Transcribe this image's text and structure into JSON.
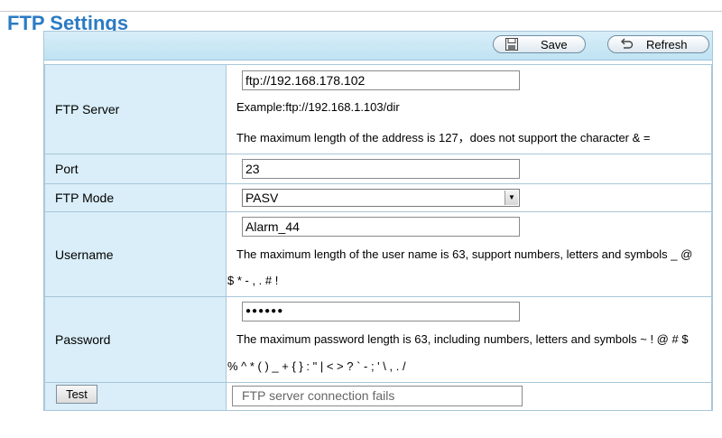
{
  "page": {
    "title": "FTP Settings"
  },
  "toolbar": {
    "save_label": "Save",
    "refresh_label": "Refresh"
  },
  "form": {
    "ftp_server": {
      "label": "FTP Server",
      "value": "ftp://192.168.178.102",
      "example": "Example:ftp://192.168.1.103/dir",
      "note": "The maximum length of the address is 127，does not support the character & ="
    },
    "port": {
      "label": "Port",
      "value": "23"
    },
    "ftp_mode": {
      "label": "FTP Mode",
      "selected": "PASV"
    },
    "username": {
      "label": "Username",
      "value": "Alarm_44",
      "note_line1": "The maximum length of the user name is 63, support numbers, letters and symbols _ @",
      "note_line2": "$ * - , . # !"
    },
    "password": {
      "label": "Password",
      "value": "●●●●●●",
      "note_line1": "The maximum password length is 63, including numbers, letters and symbols ~ ! @ # $",
      "note_line2": "% ^ * ( ) _ + { } : \" | < > ? ` - ; ' \\ , . /"
    },
    "test": {
      "button_label": "Test",
      "status": "FTP server connection fails"
    }
  },
  "colors": {
    "title": "#2b7bc4",
    "label_bg": "#d9eef8",
    "border": "#a9c7d9"
  }
}
